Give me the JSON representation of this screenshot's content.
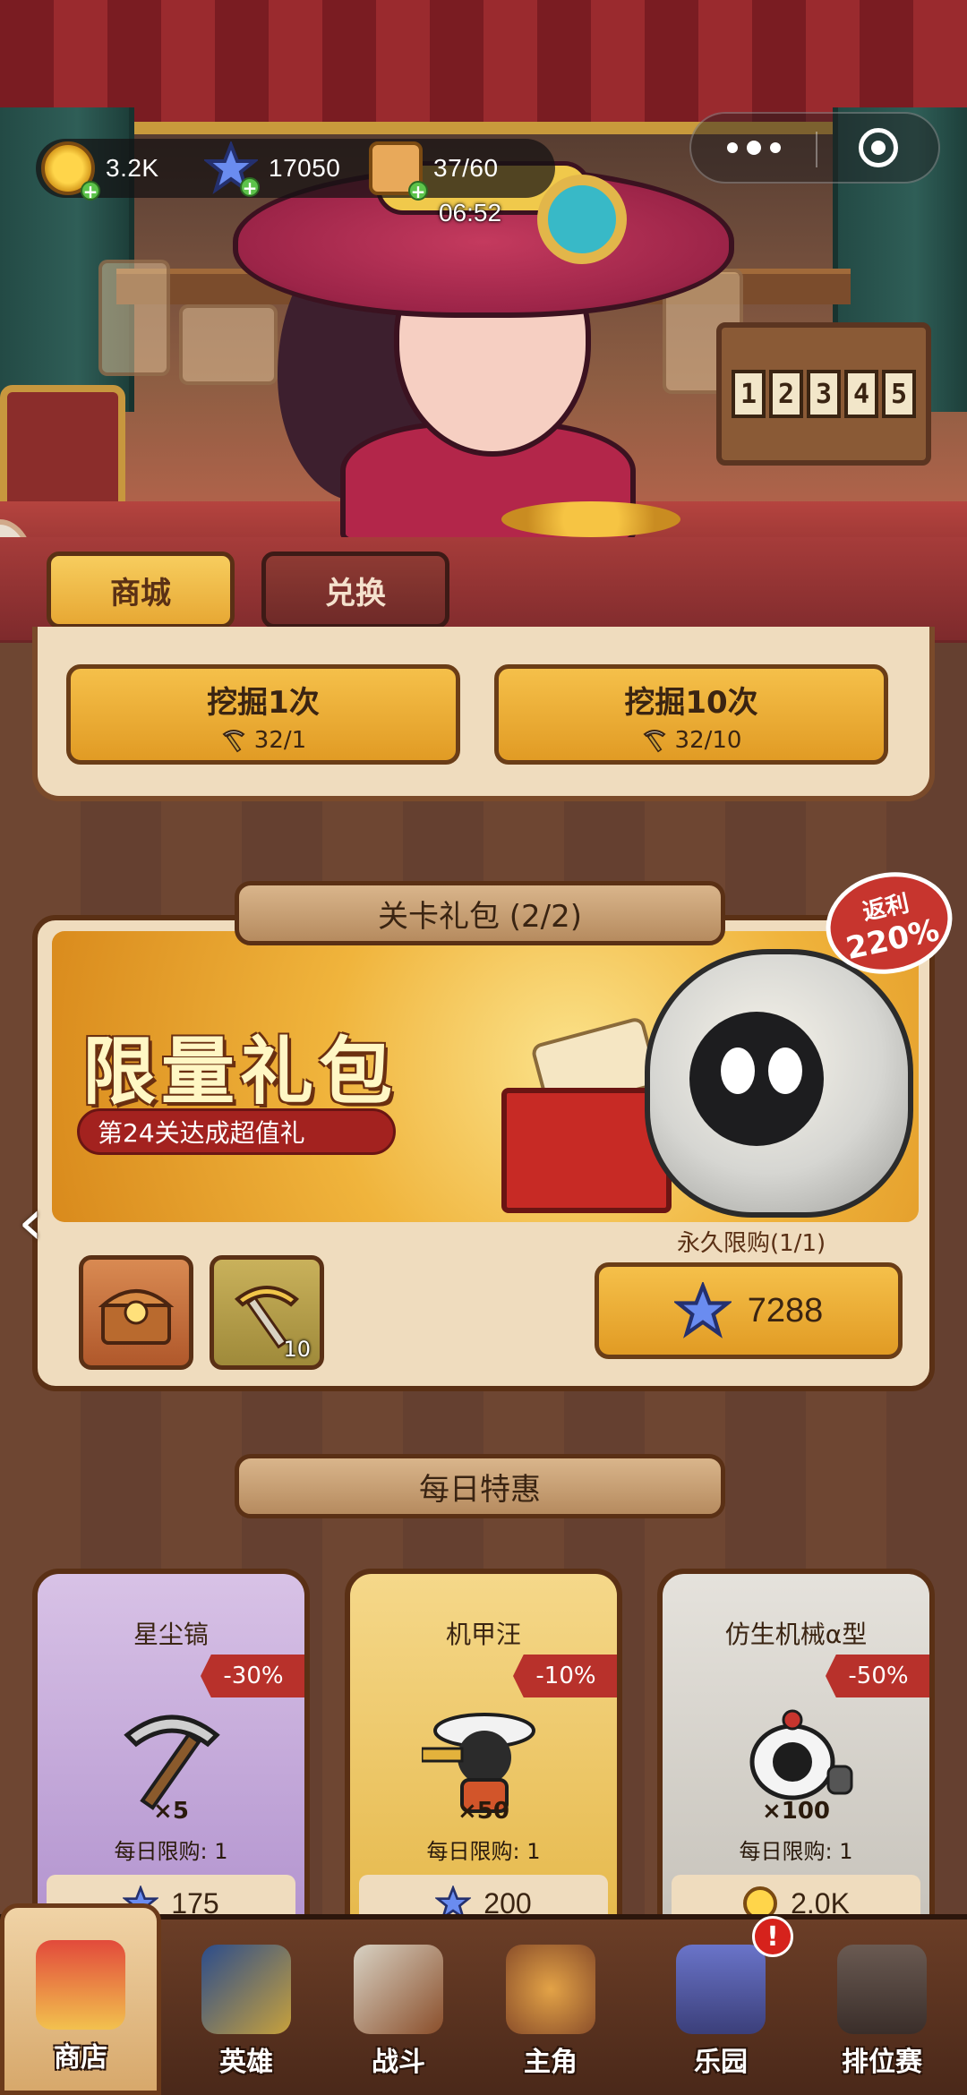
{
  "resources": {
    "coins": "3.2K",
    "stars": "17050",
    "stamina": "37/60",
    "timer": "06:52"
  },
  "tabs": {
    "shop": "商城",
    "exchange": "兑换"
  },
  "dig": {
    "once_label": "挖掘1次",
    "once_cost": "32/1",
    "ten_label": "挖掘10次",
    "ten_cost": "32/10"
  },
  "level_pack": {
    "section_title": "关卡礼包 (2/2)",
    "title": "限量礼包",
    "subtitle": "第24关达成超值礼",
    "rebate_label": "返利",
    "rebate_value": "220%",
    "limit": "永久限购(1/1)",
    "price": "7288",
    "items": [
      {
        "icon": "treasure-chest-icon",
        "count": ""
      },
      {
        "icon": "pickaxe-icon",
        "count": "10"
      }
    ]
  },
  "daily": {
    "section_title": "每日特惠",
    "deals": [
      {
        "name": "星尘镐",
        "discount": "-30%",
        "qty": "×5",
        "limit": "每日限购: 1",
        "price": "175",
        "currency": "star"
      },
      {
        "name": "机甲汪",
        "discount": "-10%",
        "qty": "×50",
        "limit": "每日限购: 1",
        "price": "200",
        "currency": "star"
      },
      {
        "name": "仿生机械α型",
        "discount": "-50%",
        "qty": "×100",
        "limit": "每日限购: 1",
        "price": "2.0K",
        "currency": "coin"
      }
    ]
  },
  "nav": [
    {
      "label": "商店",
      "icon": "shop-icon"
    },
    {
      "label": "英雄",
      "icon": "hero-cards-icon"
    },
    {
      "label": "战斗",
      "icon": "battle-icon"
    },
    {
      "label": "主角",
      "icon": "owl-icon"
    },
    {
      "label": "乐园",
      "icon": "castle-icon"
    },
    {
      "label": "排位赛",
      "icon": "lock-icon"
    }
  ],
  "colors": {
    "gold_button": "#e19b24",
    "accent_red": "#b8312b",
    "wood": "#6e4632"
  }
}
